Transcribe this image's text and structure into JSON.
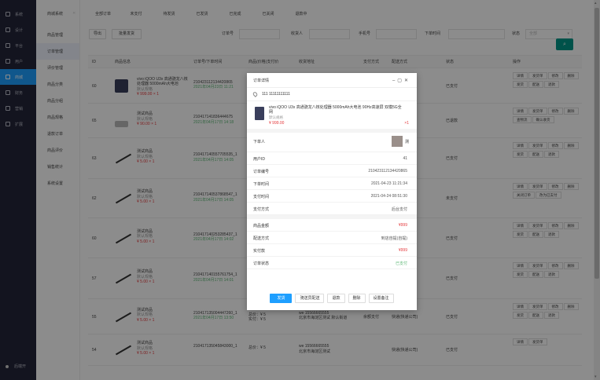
{
  "sidebar": {
    "items": [
      {
        "label": "系统",
        "icon": "gear-icon"
      },
      {
        "label": "设计",
        "icon": "design-icon"
      },
      {
        "label": "平台",
        "icon": "platform-icon"
      },
      {
        "label": "用户",
        "icon": "user-icon"
      },
      {
        "label": "商城",
        "icon": "shop-icon",
        "active": true
      },
      {
        "label": "财务",
        "icon": "finance-icon"
      },
      {
        "label": "营销",
        "icon": "marketing-icon"
      },
      {
        "label": "扩展",
        "icon": "extend-icon"
      }
    ],
    "bottom": "后端开"
  },
  "subnav": {
    "header": "商城系统",
    "items": [
      "商品管理",
      "订单管理",
      "评价管理",
      "商品分类",
      "商品分组",
      "商品规格",
      "退款订单",
      "商品评价",
      "销售统计",
      "系统设置"
    ],
    "active_index": 1
  },
  "tabs": [
    "全部订单",
    "未支付",
    "待发货",
    "已发货",
    "已完成",
    "已关闭",
    "退款中"
  ],
  "filters": {
    "export": "导出",
    "batch_ship": "批量发货",
    "order_no_label": "订单号",
    "receiver_label": "收货人",
    "phone_label": "手机号",
    "time_label": "下单时间",
    "status_label": "状态",
    "status_value": "全部"
  },
  "table": {
    "headers": [
      "ID",
      "商品信息",
      "订单号/下单时间",
      "商品(价格)支付价",
      "收货地址",
      "支付方式",
      "配送方式",
      "状态",
      "操作"
    ],
    "rows": [
      {
        "id": "60",
        "img": "phone",
        "name": "vivo iQOO U3x 高通骁龙八核处理器 5000mAh大电池",
        "spec": "默认规格",
        "price": "¥ 999.00 × 1",
        "order_no": "210423112134420865",
        "time": "2021年04月23日 11:21",
        "pay": "",
        "addr": "",
        "ship": "",
        "status": "已支付",
        "status_type": "ok",
        "ops": [
          "详情",
          "发货单",
          "修改",
          "删除",
          "发货",
          "配送",
          "退款"
        ],
        "h": 45
      },
      {
        "id": "65",
        "img": "flat",
        "name": "测试商品",
        "spec": "默认规格",
        "price": "¥ 90.00 × 1",
        "order_no": "210417141836444675",
        "time": "2021年04月17日 14:18",
        "pay": "",
        "addr": "",
        "ship": "",
        "status": "已退款",
        "status_type": "bad",
        "ops": [
          "详情",
          "发货单",
          "修改",
          "删除",
          "查物流",
          "确认收货"
        ],
        "h": 44
      },
      {
        "id": "63",
        "img": "pen",
        "name": "测试商品",
        "spec": "默认规格",
        "price": "¥ 5.00 × 1",
        "order_no": "210417140557705535_1",
        "time": "2021年04月17日 14:05",
        "pay": "",
        "addr": "",
        "ship": "",
        "status": "已支付",
        "status_type": "ok",
        "ops": [
          "详情",
          "发货单",
          "修改",
          "删除",
          "发货",
          "配送",
          "退款"
        ],
        "h": 52
      },
      {
        "id": "62",
        "img": "pen",
        "name": "测试商品",
        "spec": "默认规格",
        "price": "¥ 5.00 × 1",
        "order_no": "210417140537868547_1",
        "time": "2021年04月17日 14:05",
        "pay": "",
        "addr": "",
        "ship": "",
        "status": "未支付",
        "status_type": "bad",
        "ops": [
          "详情",
          "发货单",
          "修改",
          "删除",
          "关闭订单",
          "改为已支付"
        ],
        "h": 50
      },
      {
        "id": "60",
        "img": "pen",
        "name": "测试商品",
        "spec": "默认规格",
        "price": "¥ 5.00 × 1",
        "order_no": "210417140253285437_1",
        "time": "2021年04月17日 14:02",
        "pay": "",
        "addr": "",
        "ship": "",
        "status": "已支付",
        "status_type": "ok",
        "ops": [
          "详情",
          "发货单",
          "修改",
          "删除",
          "发货",
          "配送",
          "退款"
        ],
        "h": 51
      },
      {
        "id": "57",
        "img": "pen",
        "name": "测试商品",
        "spec": "默认规格",
        "price": "¥ 5.00 × 1",
        "order_no": "210417140155761754_1",
        "time": "2021年04月17日 14:01",
        "pay": "",
        "addr": "",
        "ship": "",
        "status": "已支付",
        "status_type": "ok",
        "ops": [
          "详情",
          "发货单",
          "修改",
          "删除",
          "发货",
          "配送",
          "退款"
        ],
        "h": 52
      },
      {
        "id": "55",
        "img": "pen",
        "name": "测试商品",
        "spec": "默认规格",
        "price": "¥ 5.00 × 1",
        "order_no": "210417135004447260_1",
        "time": "2021年04月17日 13:50",
        "pay": "总价：¥ 5\n实付：¥ 5",
        "addr": "we 15566665555\n北京市海淀区测试 默认街道",
        "paymode": "余额支付",
        "ship": "快递(快递公司)",
        "status": "已支付",
        "status_type": "ok",
        "ops": [
          "详情",
          "发货单",
          "修改",
          "删除",
          "发货",
          "配送",
          "退款"
        ],
        "h": 45
      },
      {
        "id": "54",
        "img": "pen",
        "name": "测试商品",
        "spec": "默认规格",
        "price": "¥ 5.00 × 1",
        "order_no": "210417135045843000_1",
        "time": "",
        "pay": "总价：¥ 5",
        "addr": "we 15566665555\n北京市海淀区测试",
        "paymode": "",
        "ship": "快递(快递公司)",
        "status": "已支付",
        "status_type": "ok",
        "ops": [
          "详情",
          "发货单"
        ],
        "h": 40
      }
    ]
  },
  "modal": {
    "title": "订单详情",
    "address": "111 11111111111",
    "product": {
      "title": "vivo iQOO U3x 高通骁龙八核处理器 5000mAh大电池 90Hz高速屏 双模5G全网",
      "spec": "默认规格",
      "price": "¥ 999.00",
      "qty": "×1"
    },
    "buyer_label": "下单人",
    "buyer_name": "测",
    "fields": [
      {
        "k": "用户ID",
        "v": "41",
        "style": ""
      },
      {
        "k": "订单编号",
        "v": "210423112134420865",
        "style": ""
      },
      {
        "k": "下单时间",
        "v": "2021-04-23 11:21:34",
        "style": ""
      },
      {
        "k": "支付时间",
        "v": "2021-04-24 08:51:30",
        "style": ""
      },
      {
        "k": "支付方式",
        "v": "后台支付",
        "style": ""
      }
    ],
    "fields2": [
      {
        "k": "商品金额",
        "v": "¥999",
        "style": "red"
      },
      {
        "k": "配送方式",
        "v": "到店自提(自提)",
        "style": ""
      },
      {
        "k": "实付款",
        "v": "¥999",
        "style": "red"
      },
      {
        "k": "订单状态",
        "v": "已支付",
        "style": "green"
      }
    ],
    "buttons": [
      "发货",
      "骑送员配送",
      "退款",
      "删除",
      "设置备注"
    ]
  }
}
